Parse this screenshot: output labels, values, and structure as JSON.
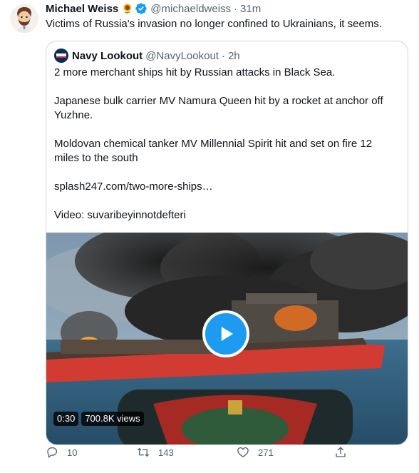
{
  "tweet": {
    "author_name": "Michael Weiss",
    "author_emoji": "🌻",
    "author_handle": "@michaeldweiss",
    "separator": "·",
    "time": "31m",
    "text": "Victims of Russia's invasion no longer confined to Ukrainians, it seems."
  },
  "quoted": {
    "author_name": "Navy Lookout",
    "author_handle": "@NavyLookout",
    "time": "2h",
    "lines": [
      "2 more merchant ships hit by Russian attacks in Black Sea.",
      "Japanese bulk carrier MV Namura Queen hit by a rocket at anchor off Yuzhne.",
      "Moldovan chemical tanker MV Millennial Spirit hit and set on fire 12 miles to the south",
      "splash247.com/two-more-ships…",
      "Video: suvaribeyinnotdefteri"
    ],
    "video": {
      "duration": "0:30",
      "views": "700.8K views"
    }
  },
  "actions": {
    "replies": "10",
    "retweets": "143",
    "likes": "271"
  },
  "colors": {
    "verified": "#1d9bf0",
    "play_button": "#1d9bf0",
    "secondary_text": "#536471",
    "border": "#cfd9de"
  },
  "icons": [
    "verified-badge-icon",
    "play-icon",
    "reply-icon",
    "retweet-icon",
    "like-icon",
    "share-icon"
  ]
}
